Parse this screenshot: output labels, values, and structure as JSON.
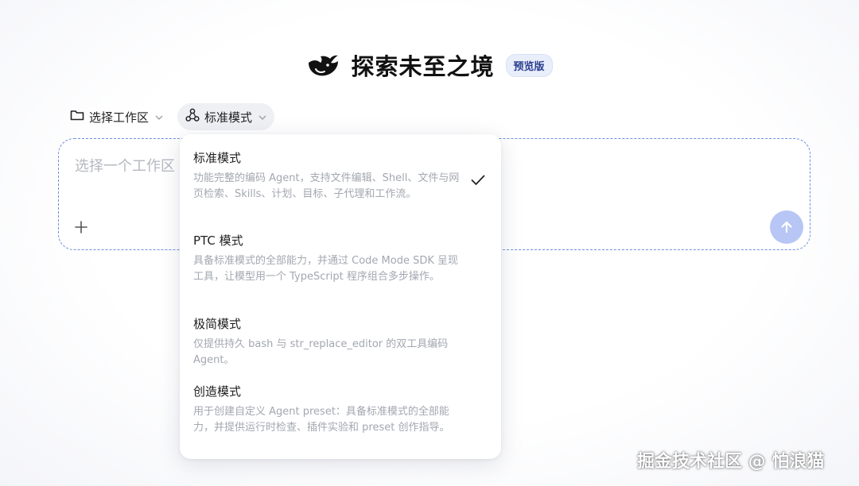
{
  "header": {
    "title": "探索未至之境",
    "badge": "预览版",
    "logo_icon": "whale-logo-icon"
  },
  "toolbar": {
    "workspace_label": "选择工作区",
    "mode_label": "标准模式"
  },
  "composer": {
    "placeholder": "选择一个工作区"
  },
  "dropdown": {
    "options": [
      {
        "title": "标准模式",
        "desc": "功能完整的编码 Agent，支持文件编辑、Shell、文件与网页检索、Skills、计划、目标、子代理和工作流。",
        "selected": true
      },
      {
        "title": "PTC 模式",
        "desc": "具备标准模式的全部能力，并通过 Code Mode SDK 呈现工具，让模型用一个 TypeScript 程序组合多步操作。",
        "selected": false
      },
      {
        "title": "极简模式",
        "desc": "仅提供持久 bash 与 str_replace_editor 的双工具编码 Agent。",
        "selected": false
      },
      {
        "title": "创造模式",
        "desc": "用于创建自定义 Agent preset：具备标准模式的全部能力，并提供运行时检查、插件实验和 preset 创作指导。",
        "selected": false
      }
    ]
  },
  "watermark": "掘金技术社区 @ 怕浪猫",
  "colors": {
    "accent": "#6b8fe0",
    "send": "#b7c6f5",
    "badge_bg": "#e9eefb"
  }
}
